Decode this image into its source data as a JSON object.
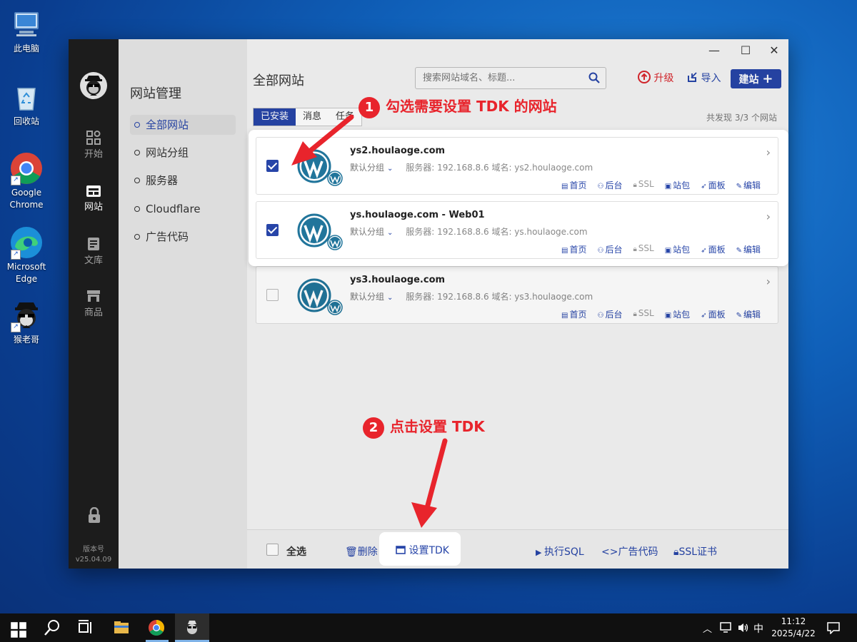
{
  "desktop": {
    "icons": [
      {
        "label": "此电脑"
      },
      {
        "label": "回收站"
      },
      {
        "label": "Google Chrome"
      },
      {
        "label": "Microsoft Edge"
      },
      {
        "label": "猴老哥"
      }
    ]
  },
  "window": {
    "controls": {
      "minimize": "—",
      "maximize": "☐",
      "close": "✕"
    }
  },
  "rail": {
    "items": [
      {
        "label": "开始"
      },
      {
        "label": "网站"
      },
      {
        "label": "文库"
      },
      {
        "label": "商品"
      }
    ],
    "version_label": "版本号",
    "version": "v25.04.09"
  },
  "subnav": {
    "title": "网站管理",
    "items": [
      {
        "label": "全部网站"
      },
      {
        "label": "网站分组"
      },
      {
        "label": "服务器"
      },
      {
        "label": "Cloudflare"
      },
      {
        "label": "广告代码"
      }
    ]
  },
  "main": {
    "title": "全部网站",
    "search_placeholder": "搜索网站域名、标题...",
    "upgrade": "升级",
    "import": "导入",
    "build": "建站",
    "tabs": [
      {
        "label": "已安装"
      },
      {
        "label": "消息"
      },
      {
        "label": "任务"
      }
    ],
    "found": "共发现 3/3 个网站",
    "sites": [
      {
        "name": "ys2.houlaoge.com",
        "group": "默认分组",
        "server": "服务器: 192.168.8.6",
        "domain": "域名: ys2.houlaoge.com",
        "checked": true
      },
      {
        "name": "ys.houlaoge.com - Web01",
        "group": "默认分组",
        "server": "服务器: 192.168.8.6",
        "domain": "域名: ys.houlaoge.com",
        "checked": true
      },
      {
        "name": "ys3.houlaoge.com",
        "group": "默认分组",
        "server": "服务器: 192.168.8.6",
        "domain": "域名: ys3.houlaoge.com",
        "checked": false
      }
    ],
    "actions": {
      "home": "首页",
      "admin": "后台",
      "ssl": "SSL",
      "package": "站包",
      "panel": "面板",
      "edit": "编辑"
    }
  },
  "bottom": {
    "select_all": "全选",
    "delete": "删除",
    "set_tdk": "设置TDK",
    "exec_sql": "执行SQL",
    "ad_code": "广告代码",
    "ssl_cert": "SSL证书"
  },
  "callouts": {
    "step1_num": "1",
    "step1_text": "勾选需要设置 TDK 的网站",
    "step2_num": "2",
    "step2_text": "点击设置 TDK",
    "color": "#e8242c"
  },
  "taskbar": {
    "ime": "中",
    "time": "11:12",
    "date": "2025/4/22"
  },
  "colors": {
    "accent": "#2745a8",
    "rail_bg": "#1e1e1e",
    "wp_blue": "#21759b"
  }
}
